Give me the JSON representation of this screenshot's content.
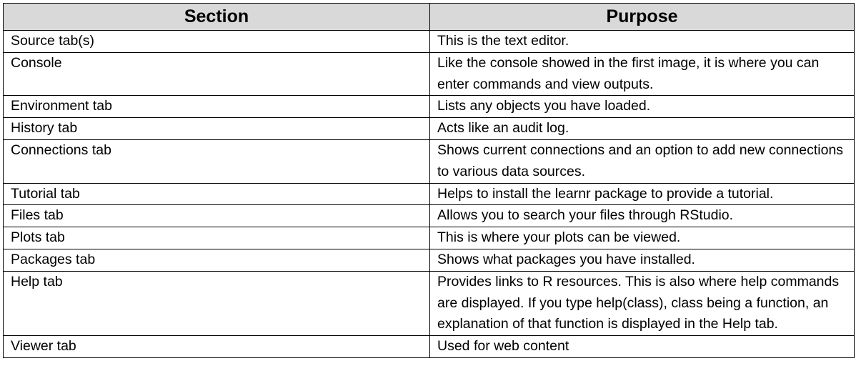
{
  "table": {
    "headers": [
      "Section",
      "Purpose"
    ],
    "rows": [
      {
        "section": "Source tab(s)",
        "purpose": "This is the text editor."
      },
      {
        "section": "Console",
        "purpose": "Like the console showed in the first image, it is where you can enter commands and view outputs."
      },
      {
        "section": "Environment tab",
        "purpose": "Lists any objects you have loaded."
      },
      {
        "section": "History tab",
        "purpose": "Acts like an audit log."
      },
      {
        "section": "Connections tab",
        "purpose": "Shows current connections and an option to add new connections to various data sources."
      },
      {
        "section": "Tutorial tab",
        "purpose": "Helps to install the learnr package to provide a tutorial."
      },
      {
        "section": "Files tab",
        "purpose": "Allows you to search your files through RStudio."
      },
      {
        "section": "Plots tab",
        "purpose": "This is where your plots can be viewed."
      },
      {
        "section": "Packages tab",
        "purpose": "Shows what packages you have installed."
      },
      {
        "section": "Help tab",
        "purpose": "Provides links to R resources. This is also where help commands are displayed. If you type help(class), class being a function, an explanation of that function is displayed in the Help tab."
      },
      {
        "section": "Viewer tab",
        "purpose": "Used for web content"
      }
    ]
  }
}
